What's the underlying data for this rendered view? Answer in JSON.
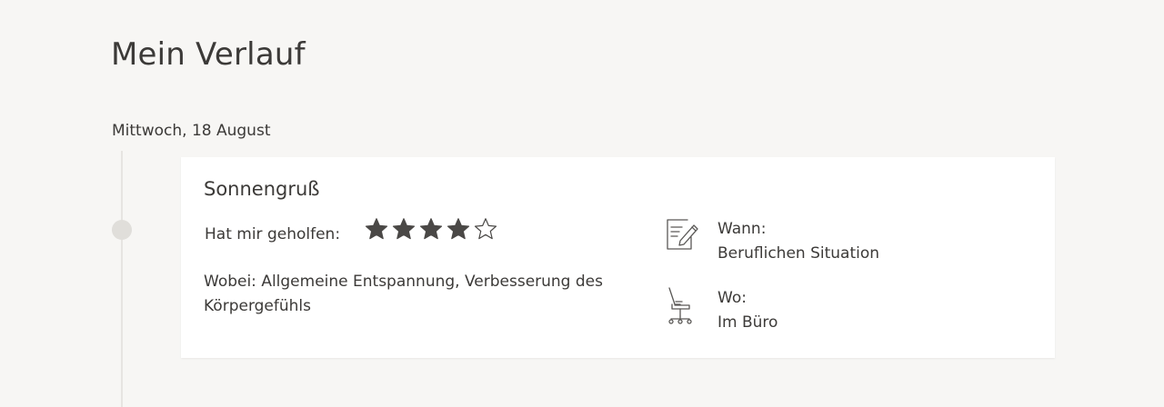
{
  "header": {
    "title": "Mein Verlauf"
  },
  "day": {
    "date_label": "Mittwoch, 18 August"
  },
  "entry": {
    "title": "Sonnengruß",
    "helped_label": "Hat mir geholfen:",
    "rating": {
      "value": 4,
      "max": 5
    },
    "wobei_text": "Wobei: Allgemeine Entspannung, Verbesserung des Körpergefühls",
    "when": {
      "icon": "note-pencil-icon",
      "label": "Wann:",
      "value": "Beruflichen Situation"
    },
    "where": {
      "icon": "office-chair-icon",
      "label": "Wo:",
      "value": "Im Büro"
    }
  },
  "colors": {
    "background": "#f7f6f4",
    "card": "#ffffff",
    "text": "#3c3a38",
    "star_filled": "#4a4846",
    "timeline": "#e0deda"
  }
}
